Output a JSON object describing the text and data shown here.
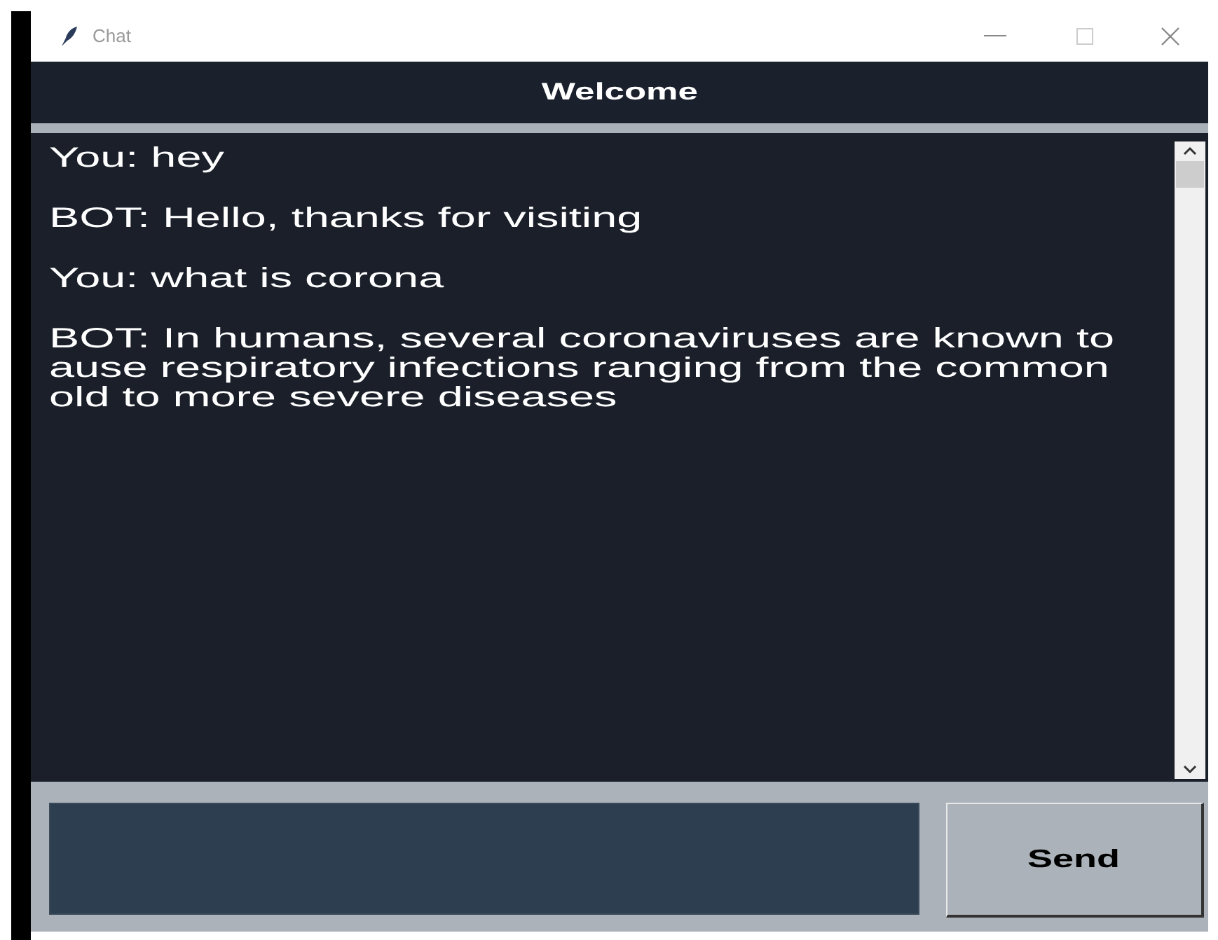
{
  "window": {
    "title": "Chat"
  },
  "header": {
    "title": "Welcome"
  },
  "messages": [
    {
      "lines": [
        "You: hey"
      ]
    },
    {
      "lines": [
        "BOT: Hello, thanks for visiting"
      ]
    },
    {
      "lines": [
        "You: what is corona"
      ]
    },
    {
      "lines": [
        "BOT: In humans, several coronaviruses are known to",
        "ause respiratory infections ranging from the common",
        "old to more severe diseases"
      ]
    }
  ],
  "send_button": {
    "label": "Send"
  }
}
